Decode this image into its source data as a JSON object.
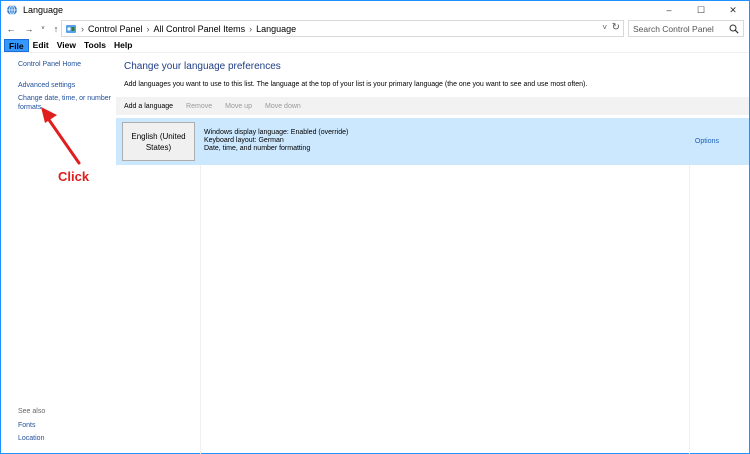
{
  "window": {
    "title": "Language",
    "controls": [
      "–",
      "☐",
      "✕"
    ]
  },
  "address": {
    "crumbs": [
      "Control Panel",
      "All Control Panel Items",
      "Language"
    ],
    "search_placeholder": "Search Control Panel"
  },
  "menu": {
    "items": [
      "File",
      "Edit",
      "View",
      "Tools",
      "Help"
    ]
  },
  "left_pane": {
    "home": "Control Panel Home",
    "advanced": "Advanced settings",
    "change_format": "Change date, time, or number formats",
    "see_also": "See also",
    "fonts": "Fonts",
    "location": "Location"
  },
  "main": {
    "title": "Change your language preferences",
    "description": "Add languages you want to use to this list. The language at the top of your list is your primary language (the one you want to see and use most often).",
    "toolbar": {
      "add": "Add a language",
      "remove": "Remove",
      "move_up": "Move up",
      "move_down": "Move down"
    },
    "language": {
      "name": "English (United States)",
      "display_language": "Windows display language: Enabled (override)",
      "keyboard": "Keyboard layout: German",
      "formatting": "Date, time, and number formatting",
      "options": "Options"
    }
  },
  "annotation": {
    "label": "Click",
    "color": "#e01e1e"
  },
  "colors": {
    "accent": "#3399ff",
    "link": "#1f4e9a",
    "selected_row": "#cce8ff"
  }
}
